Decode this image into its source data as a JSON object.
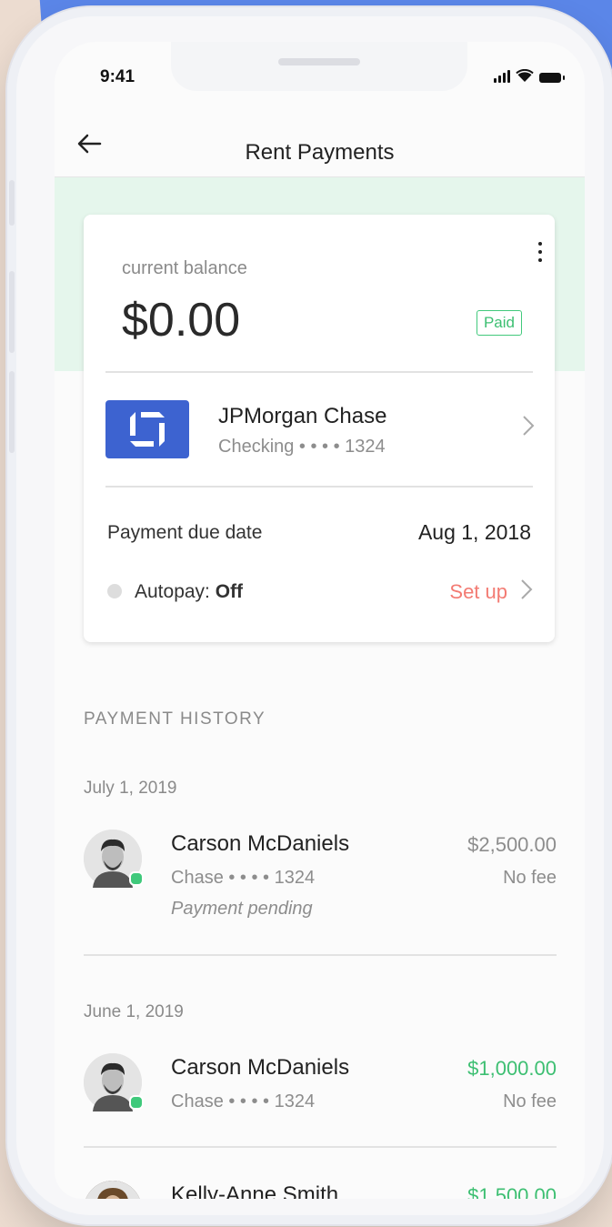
{
  "status_bar": {
    "time": "9:41"
  },
  "header": {
    "title": "Rent Payments"
  },
  "balance_card": {
    "label": "current balance",
    "value": "$0.00",
    "badge": "Paid",
    "bank": {
      "name": "JPMorgan Chase",
      "account": "Checking • • • • 1324"
    },
    "due_label": "Payment due date",
    "due_value": "Aug 1, 2018",
    "autopay_label": "Autopay: ",
    "autopay_value": "Off",
    "setup_label": "Set up"
  },
  "history": {
    "section_title": "PAYMENT HISTORY",
    "entries": [
      {
        "date": "July 1, 2019",
        "name": "Carson McDaniels",
        "account": "Chase • • • • 1324",
        "status": "Payment pending",
        "amount": "$2,500.00",
        "fee": "No fee"
      },
      {
        "date": "June 1, 2019",
        "name": "Carson McDaniels",
        "account": "Chase • • • • 1324",
        "amount": "$1,000.00",
        "fee": "No fee"
      },
      {
        "name": "Kelly-Anne Smith",
        "amount": "$1,500.00"
      }
    ]
  },
  "colors": {
    "accent_green": "#3dbf72",
    "setup_red": "#f37b73",
    "bank_blue": "#3d63d0",
    "mint": "#e5f6ec"
  }
}
